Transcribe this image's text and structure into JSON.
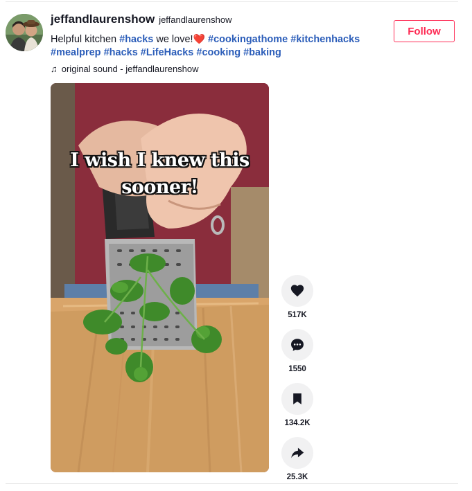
{
  "post": {
    "username": "jeffandlaurenshow",
    "handle": "jeffandlaurenshow",
    "caption_text": "Helpful kitchen",
    "caption_mid": "we love!",
    "hashtags": [
      "#hacks",
      "#cookingathome",
      "#kitchenhacks",
      "#mealprep",
      "#hacks",
      "#LifeHacks",
      "#cooking",
      "#baking"
    ],
    "sound_label": "original sound - jeffandlaurenshow",
    "follow_label": "Follow"
  },
  "video": {
    "overlay_line1": "I wish I knew this",
    "overlay_line2": "sooner!"
  },
  "actions": {
    "likes": "517K",
    "comments": "1550",
    "saves": "134.2K",
    "shares": "25.3K"
  },
  "icons": {
    "like": "heart-icon",
    "comment": "comment-icon",
    "save": "bookmark-icon",
    "share": "share-icon",
    "sound": "music-note-icon"
  },
  "colors": {
    "accent": "#fe2c55",
    "hashtag": "#2b5db9",
    "heart_emoji": "#e0283a"
  }
}
